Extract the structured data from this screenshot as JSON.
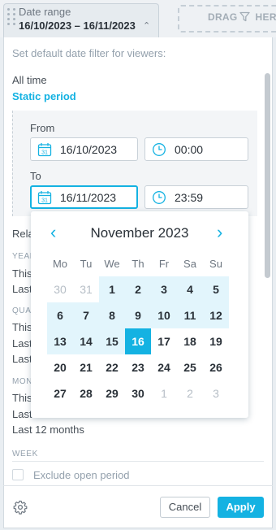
{
  "filter_chip": {
    "label": "Date range",
    "value": "16/10/2023 – 16/11/2023",
    "chevron_icon": "chevron-up-icon"
  },
  "drag_zone": {
    "label": "DRAG",
    "label_tail": "HERE",
    "icon": "filter-funnel-icon"
  },
  "panel": {
    "heading": "Set default date filter for viewers:",
    "option_all_time": "All time",
    "option_static": "Static period",
    "from_label": "From",
    "to_label": "To",
    "from_date": "16/10/2023",
    "from_time": "00:00",
    "to_date": "16/11/2023",
    "to_time": "23:59",
    "relative_partial": "Rela",
    "sections": {
      "year": {
        "title": "YEAR",
        "items": [
          "This",
          "Last"
        ]
      },
      "quarter": {
        "title": "QUA",
        "items": [
          "This",
          "Last",
          "Last"
        ]
      },
      "month": {
        "title": "MON",
        "items": [
          "This",
          "Last"
        ]
      },
      "last_12": "Last 12 months",
      "week": "WEEK"
    },
    "exclude_label": "Exclude open period",
    "settings_icon": "gear-icon"
  },
  "calendar": {
    "month_label": "November 2023",
    "weekdays": [
      "Mo",
      "Tu",
      "We",
      "Th",
      "Fr",
      "Sa",
      "Su"
    ],
    "weeks": [
      [
        "30",
        "31",
        "1",
        "2",
        "3",
        "4",
        "5"
      ],
      [
        "6",
        "7",
        "8",
        "9",
        "10",
        "11",
        "12"
      ],
      [
        "13",
        "14",
        "15",
        "16",
        "17",
        "18",
        "19"
      ],
      [
        "20",
        "21",
        "22",
        "23",
        "24",
        "25",
        "26"
      ],
      [
        "27",
        "28",
        "29",
        "30",
        "1",
        "2",
        "3"
      ]
    ],
    "selected_day": "16"
  },
  "footer": {
    "cancel_label": "Cancel",
    "apply_label": "Apply"
  },
  "colors": {
    "accent": "#14b2e2",
    "range_bg": "#e2f5fc",
    "text": "#464e56"
  }
}
